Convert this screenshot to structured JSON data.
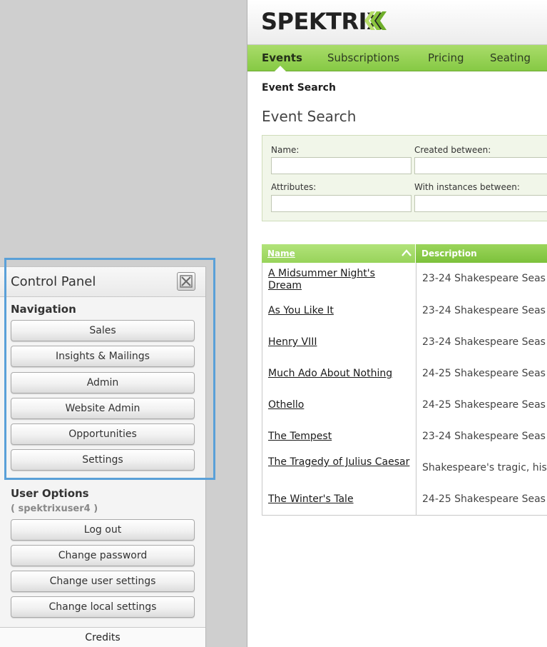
{
  "control_panel": {
    "title": "Control Panel",
    "navigation_heading": "Navigation",
    "nav_buttons": [
      "Sales",
      "Insights & Mailings",
      "Admin",
      "Website Admin",
      "Opportunities",
      "Settings"
    ],
    "user_options_heading": "User Options",
    "username": "( spektrixuser4 )",
    "user_buttons": [
      "Log out",
      "Change password",
      "Change user settings",
      "Change local settings"
    ],
    "credits": "Credits"
  },
  "app": {
    "logo_text": "SPEKTRIX",
    "nav_tabs": [
      "Events",
      "Subscriptions",
      "Pricing",
      "Seating"
    ],
    "active_tab": "Events",
    "breadcrumb": "Event Search",
    "page_title": "Event Search",
    "search": {
      "name_label": "Name:",
      "created_label": "Created between:",
      "attributes_label": "Attributes:",
      "instances_label": "With instances between:",
      "name_value": "",
      "attributes_value": ""
    },
    "grid": {
      "columns": [
        "Name",
        "Description"
      ],
      "rows": [
        {
          "name": "A Midsummer Night's Dream",
          "description": "23-24 Shakespeare Seas"
        },
        {
          "name": "As You Like It",
          "description": "23-24 Shakespeare Seas"
        },
        {
          "name": "Henry VIII",
          "description": "23-24 Shakespeare Seas"
        },
        {
          "name": "Much Ado About Nothing",
          "description": "24-25 Shakespeare Seas"
        },
        {
          "name": "Othello",
          "description": "24-25 Shakespeare Seas"
        },
        {
          "name": "The Tempest",
          "description": "23-24 Shakespeare Seas"
        },
        {
          "name": "The Tragedy of Julius Caesar",
          "description": "Shakespeare's tragic, his"
        },
        {
          "name": "The Winter's Tale",
          "description": "24-25 Shakespeare Seas"
        }
      ]
    }
  },
  "colors": {
    "nav_green": "#86c944",
    "header_green": "#9bd55b",
    "highlight_blue": "#5aa0d8",
    "logo_chevron": "#8cc63f"
  },
  "icons": {
    "close": "close-icon",
    "sort": "sort-ascending-icon",
    "logo_mark": "chevron-logo-icon"
  }
}
